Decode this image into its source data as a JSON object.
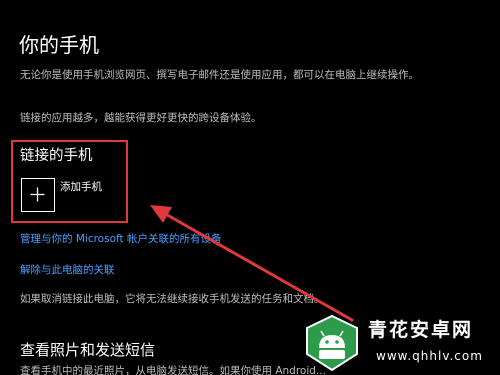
{
  "page": {
    "title": "你的手机",
    "description": "无论你是使用手机浏览网页、撰写电子邮件还是使用应用，都可以在电脑上继续操作。",
    "description2": "链接的应用越多，越能获得更好更快的跨设备体验。"
  },
  "linked_phone": {
    "title": "链接的手机",
    "add_label": "添加手机",
    "add_icon": "plus-icon"
  },
  "links": {
    "manage": "管理与你的 Microsoft 帐户关联的所有设备",
    "unlink": "解除与此电脑的关联"
  },
  "unlink_note": "如果取消链接此电脑，它将无法继续接收手机发送的任务和文档。",
  "photos_section": {
    "title": "查看照片和发送短信",
    "text": "查看手机中的最近照片，从电脑发送短信。如果你使用 Android..."
  },
  "annotation": {
    "color": "#e0393b"
  },
  "watermark": {
    "name": "青花安卓网",
    "url": "www.qhhlv.com",
    "color": "#2e9b4a"
  }
}
